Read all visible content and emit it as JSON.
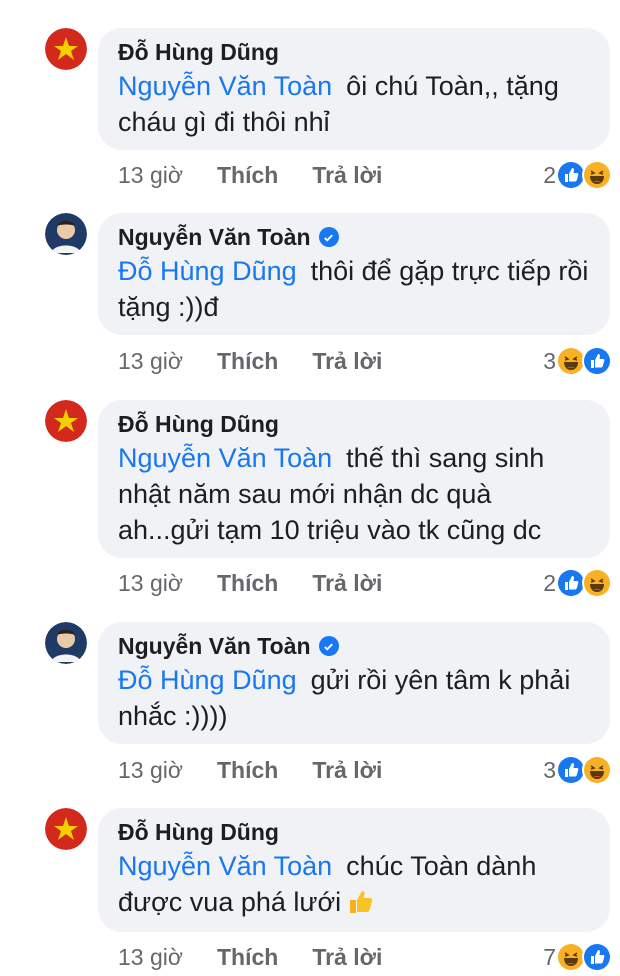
{
  "comments": [
    {
      "author": "Đỗ Hùng Dũng",
      "verified": false,
      "avatar": "vietnam-flag-avatar",
      "mention": "Nguyễn Văn Toàn",
      "text": "ôi chú Toàn,, tặng cháu gì đi thôi nhỉ",
      "time": "13 giờ",
      "like_label": "Thích",
      "reply_label": "Trả lời",
      "reaction_count": "2",
      "reactions": [
        "like-icon",
        "haha-icon"
      ]
    },
    {
      "author": "Nguyễn Văn Toàn",
      "verified": true,
      "avatar": "player-portrait-avatar",
      "mention": "Đỗ Hùng Dũng",
      "text": "thôi để gặp trực tiếp rồi tặng :))đ",
      "time": "13 giờ",
      "like_label": "Thích",
      "reply_label": "Trả lời",
      "reaction_count": "3",
      "reactions": [
        "haha-icon",
        "like-icon"
      ]
    },
    {
      "author": "Đỗ Hùng Dũng",
      "verified": false,
      "avatar": "vietnam-flag-avatar",
      "mention": "Nguyễn Văn Toàn",
      "text": "thế thì sang sinh nhật năm sau mới nhận dc quà ah...gửi tạm 10 triệu vào tk cũng dc",
      "time": "13 giờ",
      "like_label": "Thích",
      "reply_label": "Trả lời",
      "reaction_count": "2",
      "reactions": [
        "like-icon",
        "haha-icon"
      ]
    },
    {
      "author": "Nguyễn Văn Toàn",
      "verified": true,
      "avatar": "player-portrait-avatar",
      "mention": "Đỗ Hùng Dũng",
      "text": "gửi rồi yên tâm k phải nhắc :))))",
      "time": "13 giờ",
      "like_label": "Thích",
      "reply_label": "Trả lời",
      "reaction_count": "3",
      "reactions": [
        "like-icon",
        "haha-icon"
      ]
    },
    {
      "author": "Đỗ Hùng Dũng",
      "verified": false,
      "avatar": "vietnam-flag-avatar",
      "mention": "Nguyễn Văn Toàn",
      "text": "chúc Toàn dành được vua phá lưới",
      "trailing_emoji": "thumbs-up-emoji",
      "time": "13 giờ",
      "like_label": "Thích",
      "reply_label": "Trả lời",
      "reaction_count": "7",
      "reactions": [
        "haha-icon",
        "like-icon"
      ]
    }
  ],
  "colors": {
    "bubble": "#f0f2f5",
    "mention": "#1877f2",
    "meta": "#65676b",
    "like": "#1877f2",
    "haha": "#f7b125"
  }
}
